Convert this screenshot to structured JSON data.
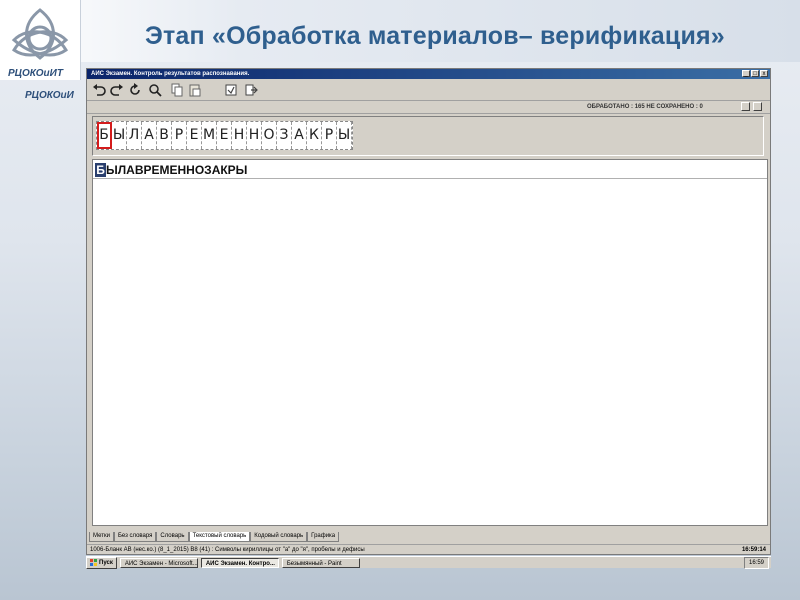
{
  "slide": {
    "title": "Этап «Обработка материалов– верификация»",
    "logo_text_1": "РЦОКОиИТ",
    "logo_text_2": "РЦОКОиИ"
  },
  "window": {
    "title": "АИС Экзамен. Контроль результатов распознавания.",
    "controls": [
      "_",
      "□",
      "x"
    ]
  },
  "toolbar": {
    "icons": [
      "undo-icon",
      "redo-icon",
      "refresh-icon",
      "search-icon",
      "copy-icon",
      "paste-icon",
      "page-icon",
      "export-icon"
    ]
  },
  "status": {
    "processed": "ОБРАБОТАНО : 165   НЕ СОХРАНЕНО : 0"
  },
  "recognition": {
    "glyphs": [
      "Б",
      "Ы",
      "Л",
      "А",
      "В",
      "Р",
      "Е",
      "М",
      "Е",
      "Н",
      "Н",
      "О",
      "З",
      "А",
      "К",
      "Р",
      "Ы"
    ],
    "selected_index": 0,
    "first_letter": "Б",
    "rest_text": "ЫЛАВРЕМЕННОЗАКРЫ"
  },
  "tabs": [
    {
      "label": "Метки",
      "active": false
    },
    {
      "label": "Без словаря",
      "active": false
    },
    {
      "label": "Словарь",
      "active": false
    },
    {
      "label": "Текстовый словарь",
      "active": true
    },
    {
      "label": "Кодовый словарь",
      "active": false
    },
    {
      "label": "Графика",
      "active": false
    }
  ],
  "bottom_status": {
    "info": "1006-Бланк АВ (нес.ко.) (8_1_2015)   В8 (41) : Символы кириллицы от \"а\" до \"я\", пробелы и дефисы",
    "clock": "16:59:14"
  },
  "taskbar": {
    "start": "Пуск",
    "tasks": [
      {
        "label": "АИС Экзамен - Microsoft...",
        "active": false
      },
      {
        "label": "АИС Экзамен. Контро...",
        "active": true
      },
      {
        "label": "Безымянный - Paint",
        "active": false
      }
    ],
    "clock": "16:59"
  },
  "colors": {
    "title": "#2f5f8e",
    "selection": "#d41c1c",
    "highlight": "#2a3f6e"
  }
}
